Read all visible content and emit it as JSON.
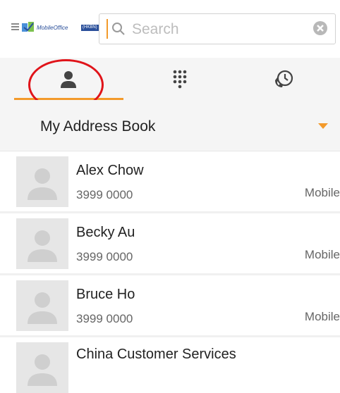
{
  "header": {
    "logo_text": "MobileOffice",
    "logo_badge": "(HKBN)",
    "search_placeholder": "Search"
  },
  "tabs": [
    {
      "icon": "person-icon",
      "active": true
    },
    {
      "icon": "dialpad-icon",
      "active": false
    },
    {
      "icon": "call-history-icon",
      "active": false
    }
  ],
  "address_book": {
    "label": "My Address Book"
  },
  "contacts": [
    {
      "name": "Alex Chow",
      "number": "3999 0000",
      "type": "Mobile"
    },
    {
      "name": "Becky Au",
      "number": "3999 0000",
      "type": "Mobile"
    },
    {
      "name": "Bruce Ho",
      "number": "3999 0000",
      "type": "Mobile"
    },
    {
      "name": "China Customer Services"
    }
  ],
  "colors": {
    "accent": "#f39a2b",
    "annotation": "#e0141a"
  }
}
